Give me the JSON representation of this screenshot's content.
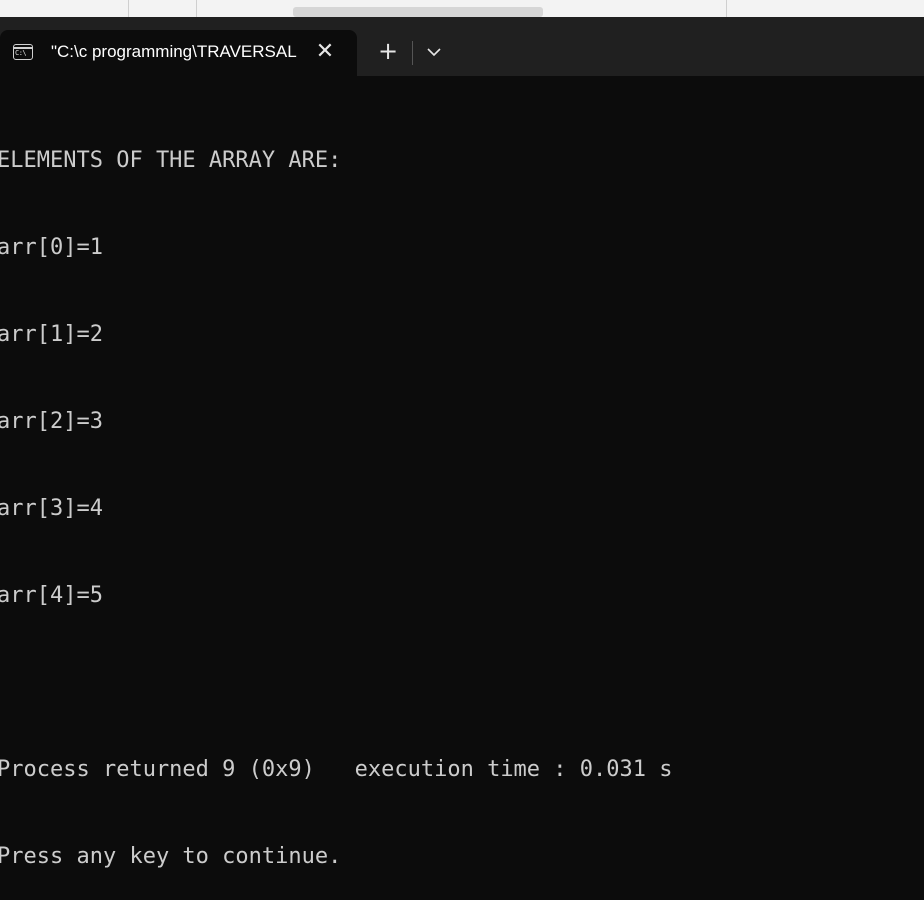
{
  "tab": {
    "title": "\"C:\\c programming\\TRAVERSAL.exe\"",
    "icon": "terminal-icon",
    "close_icon": "close-icon"
  },
  "toolbar": {
    "new_tab_label": "+",
    "dropdown_icon": "chevron-down-icon"
  },
  "console": {
    "lines": [
      "ELEMENTS OF THE ARRAY ARE:",
      "arr[0]=1",
      "arr[1]=2",
      "arr[2]=3",
      "arr[3]=4",
      "arr[4]=5",
      "",
      "Process returned 9 (0x9)   execution time : 0.031 s",
      "Press any key to continue."
    ]
  },
  "colors": {
    "background": "#0c0c0c",
    "tabbar": "#202020",
    "text": "#cccccc"
  }
}
